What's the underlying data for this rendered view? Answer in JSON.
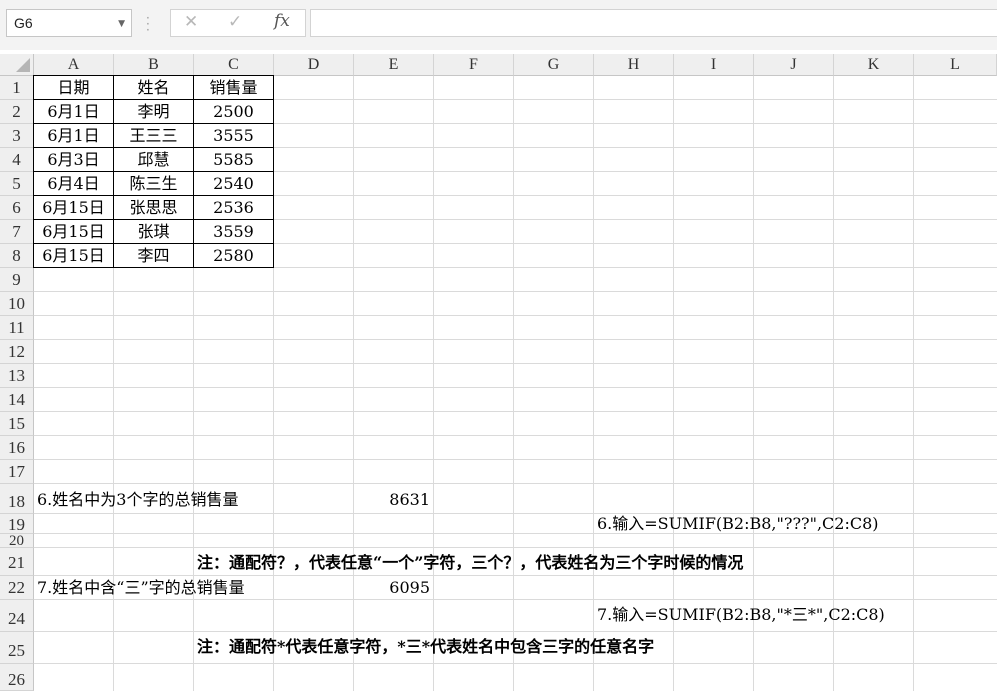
{
  "formula_bar": {
    "name_box": "G6",
    "cancel_icon": "✕",
    "enter_icon": "✓",
    "function_label": "fx",
    "formula": ""
  },
  "columns": [
    "A",
    "B",
    "C",
    "D",
    "E",
    "F",
    "G",
    "H",
    "I",
    "J",
    "K",
    "L"
  ],
  "rows": [
    "1",
    "2",
    "3",
    "4",
    "5",
    "6",
    "7",
    "8",
    "9",
    "10",
    "11",
    "12",
    "13",
    "14",
    "15",
    "16",
    "17",
    "18",
    "19",
    "20",
    "21",
    "22",
    "24",
    "25",
    "26"
  ],
  "table": {
    "headers": [
      "日期",
      "姓名",
      "销售量"
    ],
    "data": [
      [
        "6月1日",
        "李明",
        "2500"
      ],
      [
        "6月1日",
        "王三三",
        "3555"
      ],
      [
        "6月3日",
        "邱慧",
        "5585"
      ],
      [
        "6月4日",
        "陈三生",
        "2540"
      ],
      [
        "6月15日",
        "张思思",
        "2536"
      ],
      [
        "6月15日",
        "张琪",
        "3559"
      ],
      [
        "6月15日",
        "李四",
        "2580"
      ]
    ]
  },
  "content": {
    "q6_label": "6.姓名中为3个字的总销售量",
    "q6_value": "8631",
    "q6_formula": "6.输入=SUMIF(B2:B8,\"???\",C2:C8)",
    "note1": "注：通配符？，代表任意“一个”字符，三个？，代表姓名为三个字时候的情况",
    "q7_label": "7.姓名中含“三”字的总销售量",
    "q7_value": "6095",
    "q7_formula": "7.输入=SUMIF(B2:B8,\"*三*\",C2:C8)",
    "note2": "注：通配符*代表任意字符，*三*代表姓名中包含三字的任意名字"
  }
}
